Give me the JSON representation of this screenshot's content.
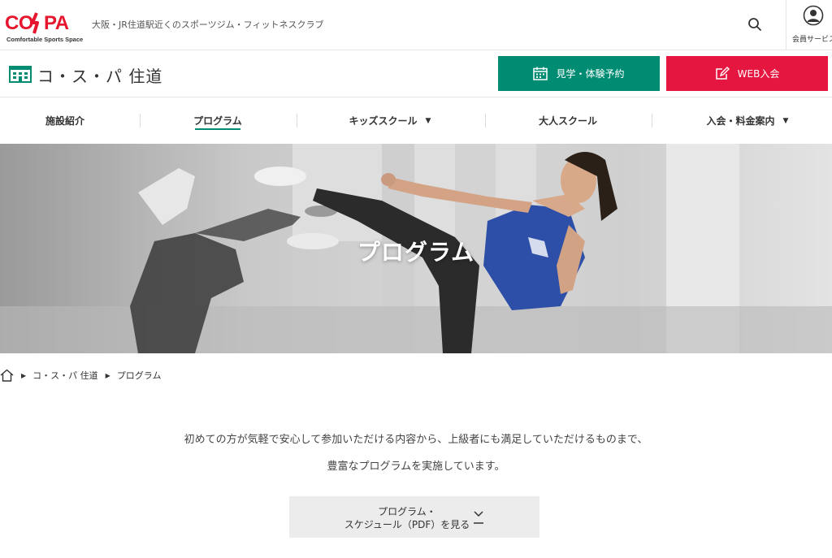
{
  "header": {
    "logo_text": "CO PA",
    "logo_tagline": "Comfortable Sports Space",
    "tagline": "大阪・JR住道駅近くのスポーツジム・フィットネスクラブ",
    "member_label": "会員サービス",
    "brand_color": "#e5162d"
  },
  "gym": {
    "name": "コ・ス・パ 住道",
    "visit_label": "見学・体験予約",
    "join_label": "WEB入会",
    "visit_color": "#008c72",
    "join_color": "#e5163f"
  },
  "nav": {
    "items": [
      {
        "label": "施設紹介",
        "dropdown": false,
        "active": false
      },
      {
        "label": "プログラム",
        "dropdown": false,
        "active": true
      },
      {
        "label": "キッズスクール",
        "dropdown": true,
        "active": false
      },
      {
        "label": "大人スクール",
        "dropdown": false,
        "active": false
      },
      {
        "label": "入会・料金案内",
        "dropdown": true,
        "active": false
      }
    ]
  },
  "hero": {
    "title": "プログラム"
  },
  "breadcrumb": {
    "items": [
      "コ・ス・パ 住道",
      "プログラム"
    ]
  },
  "intro": {
    "line1": "初めての方が気軽で安心して参加いただける内容から、上級者にも満足していただけるものまで、",
    "line2": "豊富なプログラムを実施しています。"
  },
  "pdf_button": {
    "line1": "プログラム・",
    "line2": "スケジュール（PDF）を見る"
  },
  "icons": {
    "search": "search-icon",
    "member": "user-circle-icon",
    "gym": "building-icon",
    "visit": "calendar-icon",
    "join": "edit-icon",
    "home": "home-icon",
    "pdf": "download-icon"
  }
}
